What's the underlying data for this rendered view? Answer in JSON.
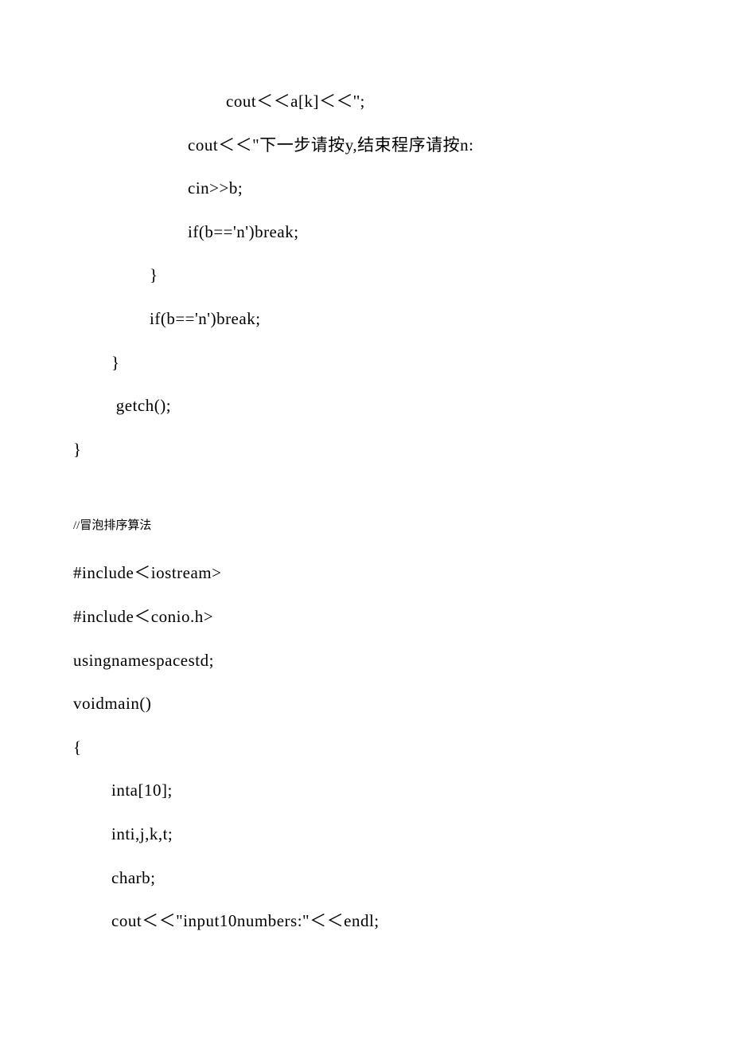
{
  "code1": {
    "line1": "cout＜＜a[k]＜＜'';",
    "line2": "cout＜＜\"下一步请按y,结束程序请按n:",
    "line3": "cin>>b;",
    "line4": "if(b=='n')break;",
    "line5": "}",
    "line6": "if(b=='n')break;",
    "line7": "}",
    "line8": " getch();",
    "line9": "}"
  },
  "comment": "//冒泡排序算法",
  "code2": {
    "line1": "#include＜iostream>",
    "line2": "#include＜conio.h>",
    "line3": "usingnamespacestd;",
    "line4": "voidmain()",
    "line5": "{",
    "line6": "inta[10];",
    "line7": "inti,j,k,t;",
    "line8": "charb;",
    "line9": "cout＜＜\"input10numbers:\"＜＜endl;"
  }
}
